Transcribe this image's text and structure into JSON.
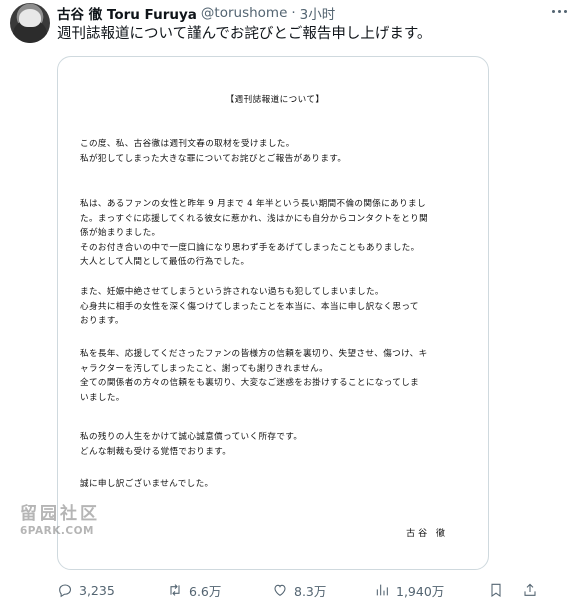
{
  "author": {
    "name": "古谷 徹 Toru Furuya",
    "handle": "@torushome",
    "separator": "·",
    "time": "3小时"
  },
  "tweet": {
    "text": "週刊誌報道について謹んでお詫びとご報告申し上げます。"
  },
  "letter": {
    "title": "【週刊誌報道について】",
    "paragraphs": [
      "この度、私、古谷徹は週刊文春の取材を受けました。\n私が犯してしまった大きな罪についてお詫びとご報告があります。",
      "私は、あるファンの女性と昨年 9 月まで 4 年半という長い期間不倫の関係にありまし\nた。まっすぐに応援してくれる彼女に惹かれ、浅はかにも自分からコンタクトをとり関\n係が始まりました。\nそのお付き合いの中で一度口論になり思わず手をあげてしまったこともありました。\n大人として人間として最低の行為でした。",
      "また、妊娠中絶させてしまうという許されない過ちも犯してしまいました。\n心身共に相手の女性を深く傷つけてしまったことを本当に、本当に申し訳なく思って\nおります。",
      "私を長年、応援してくださったファンの皆様方の信頼を裏切り、失望させ、傷つけ、キ\nャラクターを汚してしまったこと、謝っても謝りきれません。\n全ての関係者の方々の信頼をも裏切り、大変なご迷惑をお掛けすることになってしま\nいました。",
      "私の残りの人生をかけて誠心誠意償っていく所存です。\nどんな制裁も受ける覚悟でおります。",
      "誠に申し訳ございませんでした。"
    ],
    "signature": "古谷 徹"
  },
  "watermark": {
    "top": "留园社区",
    "bottom": "6PARK.COM"
  },
  "actions": {
    "replies": "3,235",
    "retweets": "6.6万",
    "likes": "8.3万",
    "views": "1,940万"
  },
  "icons": {
    "more": "more-horizontal-icon",
    "reply": "reply-icon",
    "retweet": "retweet-icon",
    "like": "heart-icon",
    "views": "views-icon",
    "bookmark": "bookmark-icon",
    "share": "share-icon"
  },
  "colors": {
    "text": "#0f1419",
    "secondary": "#536471",
    "border": "#cfd9de"
  }
}
